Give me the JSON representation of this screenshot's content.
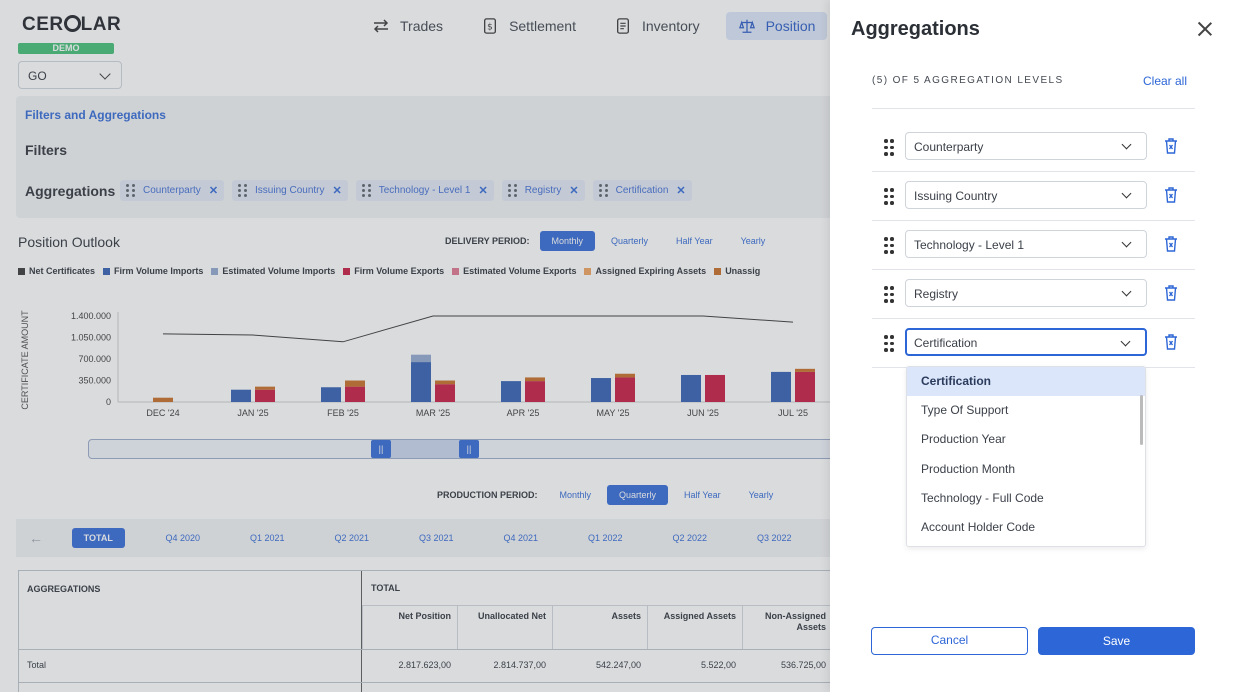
{
  "app": {
    "logo": "CERQLAR",
    "logo_parts": [
      "CER",
      "LAR"
    ],
    "env_badge": "DEMO",
    "nav": [
      {
        "label": "Trades",
        "icon": "swap-icon"
      },
      {
        "label": "Settlement",
        "icon": "dollar-doc-icon"
      },
      {
        "label": "Inventory",
        "icon": "document-icon"
      },
      {
        "label": "Position",
        "icon": "scale-icon",
        "active": true
      }
    ],
    "entity_select": "GO"
  },
  "filters_panel": {
    "link": "Filters and Aggregations",
    "filters_title": "Filters",
    "aggregations_title": "Aggregations",
    "chips": [
      "Counterparty",
      "Issuing Country",
      "Technology - Level 1",
      "Registry",
      "Certification"
    ]
  },
  "outlook": {
    "title": "Position Outlook",
    "delivery_label": "DELIVERY PERIOD:",
    "delivery_options": [
      "Monthly",
      "Quarterly",
      "Half Year",
      "Yearly"
    ],
    "delivery_selected": "Monthly",
    "legend": [
      {
        "name": "Net Certificates",
        "color": "#333333"
      },
      {
        "name": "Firm Volume Imports",
        "color": "#2d5bb0"
      },
      {
        "name": "Estimated Volume Imports",
        "color": "#8fa6cf"
      },
      {
        "name": "Firm Volume Exports",
        "color": "#c8143c"
      },
      {
        "name": "Estimated Volume Exports",
        "color": "#e0738c"
      },
      {
        "name": "Assigned Expiring Assets",
        "color": "#f0a15a"
      },
      {
        "name": "Unassig",
        "color": "#c86a1e"
      }
    ],
    "production_label": "PRODUCTION PERIOD:",
    "production_options": [
      "Monthly",
      "Quarterly",
      "Half Year",
      "Yearly"
    ],
    "production_selected": "Quarterly",
    "scroller_handle": "||"
  },
  "chart_data": {
    "type": "bar",
    "ylabel": "CERTIFICATE AMOUNT",
    "y_ticks": [
      "1.400.000",
      "1.050.000",
      "700.000",
      "350.000",
      "0"
    ],
    "ylim": [
      0,
      1400000
    ],
    "categories": [
      "DEC '24",
      "JAN '25",
      "FEB '25",
      "MAR '25",
      "APR '25",
      "MAY '25",
      "JUN '25",
      "JUL '25"
    ],
    "series": [
      {
        "name": "Firm Volume Imports",
        "color": "#2d5bb0",
        "type": "bar",
        "stack": "imports",
        "values": [
          0,
          200000,
          240000,
          650000,
          340000,
          390000,
          440000,
          490000
        ]
      },
      {
        "name": "Estimated Volume Imports",
        "color": "#8fa6cf",
        "type": "bar",
        "stack": "imports",
        "values": [
          0,
          0,
          0,
          120000,
          0,
          0,
          0,
          0
        ]
      },
      {
        "name": "Firm Volume Exports",
        "color": "#c8143c",
        "type": "bar",
        "stack": "exports",
        "values": [
          0,
          200000,
          250000,
          290000,
          340000,
          400000,
          440000,
          490000
        ]
      },
      {
        "name": "Unassig",
        "color": "#c86a1e",
        "type": "bar",
        "stack": "exports",
        "values": [
          70000,
          50000,
          100000,
          60000,
          60000,
          60000,
          0,
          50000
        ]
      },
      {
        "name": "Net Certificates",
        "color": "#333333",
        "type": "line",
        "values": [
          1110000,
          1090000,
          980000,
          1400000,
          1400000,
          1400000,
          1400000,
          1300000
        ]
      }
    ]
  },
  "quarter_bar": {
    "items": [
      "TOTAL",
      "Q4 2020",
      "Q1 2021",
      "Q2 2021",
      "Q3 2021",
      "Q4 2021",
      "Q1 2022",
      "Q2 2022",
      "Q3 2022"
    ],
    "selected": "TOTAL"
  },
  "table": {
    "aggregations_header": "AGGREGATIONS",
    "total_header": "TOTAL",
    "columns": [
      "Net Position",
      "Unallocated Net",
      "Assets",
      "Assigned Assets",
      "Non-Assigned Assets"
    ],
    "rows": [
      {
        "label": "Total",
        "values": [
          "2.817.623,00",
          "2.814.737,00",
          "542.247,00",
          "5.522,00",
          "536.725,00"
        ]
      }
    ]
  },
  "drawer": {
    "title": "Aggregations",
    "count": "(5) OF 5 AGGREGATION LEVELS",
    "clear_all": "Clear all",
    "levels": [
      "Counterparty",
      "Issuing Country",
      "Technology - Level 1",
      "Registry",
      "Certification"
    ],
    "dropdown_options": [
      "Certification",
      "Type Of Support",
      "Production Year",
      "Production Month",
      "Technology - Full Code",
      "Account Holder Code"
    ],
    "dropdown_selected": "Certification",
    "cancel": "Cancel",
    "save": "Save"
  }
}
